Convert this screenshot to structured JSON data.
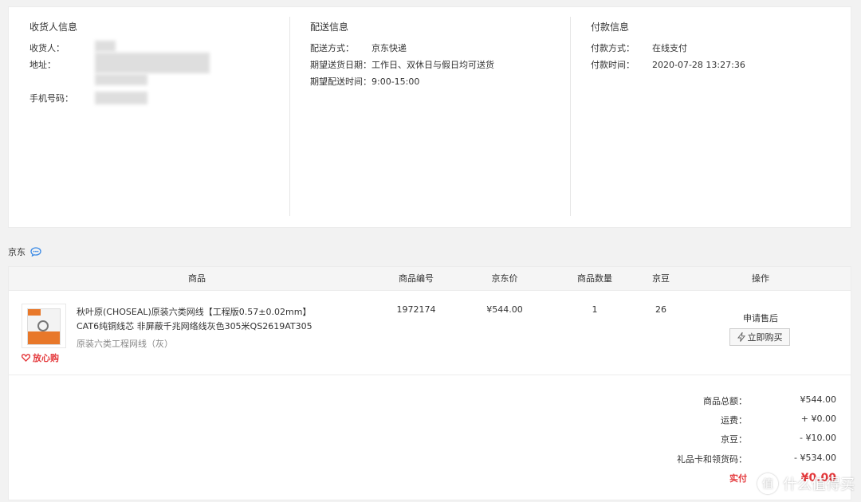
{
  "receiver": {
    "title": "收货人信息",
    "name_label": "收货人：",
    "address_label": "地址：",
    "phone_label": "手机号码："
  },
  "delivery": {
    "title": "配送信息",
    "method_label": "配送方式：",
    "method_value": "京东快递",
    "date_label": "期望送货日期：",
    "date_value": "工作日、双休日与假日均可送货",
    "time_label": "期望配送时间：",
    "time_value": "9:00-15:00"
  },
  "payment": {
    "title": "付款信息",
    "method_label": "付款方式：",
    "method_value": "在线支付",
    "time_label": "付款时间：",
    "time_value": "2020-07-28 13:27:36"
  },
  "store": {
    "name": "京东"
  },
  "table": {
    "headers": [
      "商品",
      "商品编号",
      "京东价",
      "商品数量",
      "京豆",
      "操作"
    ],
    "product": {
      "name": "秋叶原(CHOSEAL)原装六类网线【工程版0.57±0.02mm】CAT6纯铜线芯 非屏蔽千兆网络线灰色305米QS2619AT305",
      "spec": "原装六类工程网线（灰）",
      "badge": "放心购",
      "sku": "1972174",
      "price": "¥544.00",
      "quantity": "1",
      "jingdou": "26",
      "aftersale_label": "申请售后",
      "buy_label": "立即购买"
    }
  },
  "summary": {
    "total_label": "商品总额：",
    "total_value": "¥544.00",
    "shipping_label": "运费：",
    "shipping_value": "+ ¥0.00",
    "jingdou_label": "京豆：",
    "jingdou_value": "- ¥10.00",
    "giftcard_label": "礼品卡和领货码：",
    "giftcard_value": "- ¥534.00",
    "actual_label": "实付",
    "actual_value": "¥0.00"
  },
  "watermark": {
    "text": "什么值得买",
    "icon_char": "值"
  },
  "colors": {
    "accent_red": "#e4393c",
    "link_blue": "#3b8ae6"
  }
}
